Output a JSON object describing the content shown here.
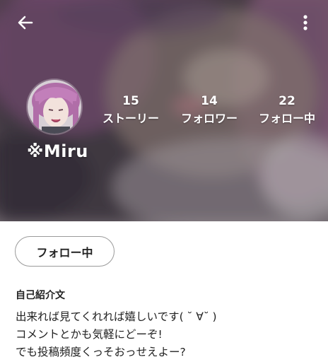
{
  "profile": {
    "username": "※Miru",
    "stats": [
      {
        "value": "15",
        "label": "ストーリー"
      },
      {
        "value": "14",
        "label": "フォロワー"
      },
      {
        "value": "22",
        "label": "フォロー中"
      }
    ],
    "follow_button_label": "フォロー中",
    "bio_title": "自己紹介文",
    "bio_lines": [
      "出来れば見てくれれば嬉しいです( ˘ ∀˘ )",
      "コメントとかも気軽にどーぞ!",
      "でも投稿頻度くっそおっせえよー?"
    ]
  },
  "icons": {
    "back": "back-arrow-icon",
    "more": "more-vertical-icon"
  }
}
